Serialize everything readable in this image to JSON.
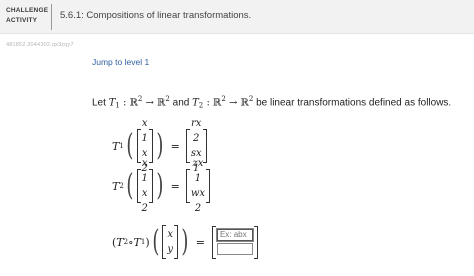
{
  "header": {
    "badge_line1": "CHALLENGE",
    "badge_line2": "ACTIVITY",
    "title": "5.6.1: Compositions of linear transformations."
  },
  "activity_id": "481852.3044302.qx3zqy7",
  "jump_link": "Jump to level 1",
  "intro": {
    "prefix": "Let ",
    "t1": "T",
    "t1_sub": "1",
    "colon1": " : ",
    "r": "ℝ",
    "sup": "2",
    "arrow": " → ",
    "and": " and ",
    "t2": "T",
    "t2_sub": "2",
    "suffix": " be linear transformations defined as follows."
  },
  "eq1": {
    "lhs": "T",
    "lhs_sub": "1",
    "in_top": "x",
    "in_top_sub": "1",
    "in_bottom": "x",
    "in_bottom_sub": "2",
    "eq": "=",
    "out_top": "rx",
    "out_top_sub": "2",
    "out_bottom": "sx",
    "out_bottom_sub": "1"
  },
  "eq2": {
    "lhs": "T",
    "lhs_sub": "2",
    "in_top": "x",
    "in_top_sub": "1",
    "in_bottom": "x",
    "in_bottom_sub": "2",
    "eq": "=",
    "out_top": "zx",
    "out_top_sub": "1",
    "out_bottom": "wx",
    "out_bottom_sub": "2"
  },
  "eq3": {
    "lhs_open": "(",
    "t2": "T",
    "t2_sub": "2",
    "circ": " ∘ ",
    "t1": "T",
    "t1_sub": "1",
    "lhs_close": ")",
    "in_top": "x",
    "in_bottom": "y",
    "eq": "=",
    "input_top_placeholder": "Ex: abx",
    "input_bottom_placeholder": ""
  }
}
